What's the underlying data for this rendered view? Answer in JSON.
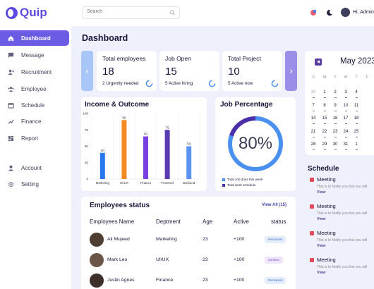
{
  "app": {
    "logo_text": "Quip"
  },
  "topbar": {
    "search_placeholder": "Search",
    "greeting": "Hi, Admin"
  },
  "sidebar": {
    "items": [
      {
        "label": "Dashboard",
        "icon": "home-icon",
        "active": true
      },
      {
        "label": "Message",
        "icon": "message-icon"
      },
      {
        "label": "Recruitment",
        "icon": "recruitment-icon"
      },
      {
        "label": "Employee",
        "icon": "employee-icon"
      },
      {
        "label": "Schedule",
        "icon": "schedule-icon"
      },
      {
        "label": "Finance",
        "icon": "finance-icon"
      },
      {
        "label": "Report",
        "icon": "report-icon"
      },
      {
        "label": "Account",
        "icon": "account-icon"
      },
      {
        "label": "Setting",
        "icon": "gear-icon"
      }
    ]
  },
  "page": {
    "title": "Dashboard"
  },
  "stats": [
    {
      "title": "Total employees",
      "value": "18",
      "sub": "2 Urgently needed"
    },
    {
      "title": "Job Open",
      "value": "15",
      "sub": "5 Active hiring"
    },
    {
      "title": "Total Project",
      "value": "10",
      "sub": "5 Active now"
    }
  ],
  "income": {
    "title": "Income & Outcome",
    "chart_data": {
      "type": "bar",
      "categories": [
        "Marketing",
        "UI/UX",
        "Finance",
        "Frontend",
        "Backend"
      ],
      "values": [
        40,
        90,
        65,
        75,
        50
      ],
      "bar_labels": [
        "40",
        "90",
        "60",
        "75",
        "50"
      ],
      "colors": [
        "#2a78f0",
        "#f58a22",
        "#7a3fe0",
        "#5a3ab0",
        "#5b93f0"
      ],
      "ylim": [
        0,
        100
      ],
      "yticks": [
        "0",
        "25",
        "50",
        "75",
        "100"
      ]
    }
  },
  "job": {
    "title": "Job Percentage",
    "value_text": "80%",
    "progress": 0.8,
    "legend": [
      "Total Job done this week",
      "Total work schedule"
    ],
    "colors": {
      "done": "#4a90f0",
      "schedule": "#4b2fa8"
    }
  },
  "calendar": {
    "month": "May 2023",
    "weekdays": [
      "S",
      "M",
      "T",
      "W",
      "T",
      "F",
      "S"
    ],
    "rows": [
      [
        "30",
        "1",
        "2",
        "3",
        "4"
      ],
      [
        "7",
        "8",
        "9",
        "10",
        "11"
      ],
      [
        "14",
        "15",
        "16",
        "17",
        "18"
      ],
      [
        "21",
        "22",
        "23",
        "24",
        "25"
      ],
      [
        "28",
        "29",
        "30",
        "31",
        "1"
      ]
    ]
  },
  "schedule": {
    "title": "Schedule",
    "items": [
      {
        "title": "Meeting",
        "desc": "This is to Notify you that you will",
        "link": "View"
      },
      {
        "title": "Meeting",
        "desc": "This is to Notify you that you will",
        "link": "View"
      },
      {
        "title": "Meeting",
        "desc": "This is to Notify you that you will",
        "link": "View"
      },
      {
        "title": "Meeting",
        "desc": "This is to Notify you that you will",
        "link": "View"
      }
    ]
  },
  "employees": {
    "title": "Employees status",
    "view_all": "View All (15)",
    "columns": [
      "Employees Name",
      "Deptment",
      "Age",
      "Active",
      "status"
    ],
    "rows": [
      {
        "name": "Ali Mujeed",
        "dept": "Marketing",
        "age": "23",
        "active": "+100",
        "status": "Permanent"
      },
      {
        "name": "Mark Leo",
        "dept": "UI/UX",
        "age": "23",
        "active": "+100",
        "status": "Contract"
      },
      {
        "name": "Justin Agnes",
        "dept": "Finance",
        "age": "23",
        "active": "+100",
        "status": "Permanent"
      }
    ]
  }
}
